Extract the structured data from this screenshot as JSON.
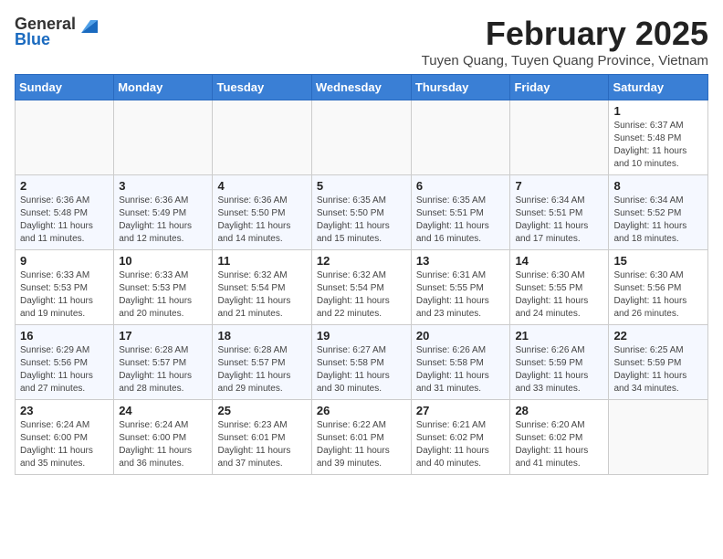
{
  "header": {
    "logo_general": "General",
    "logo_blue": "Blue",
    "month_title": "February 2025",
    "location": "Tuyen Quang, Tuyen Quang Province, Vietnam"
  },
  "weekdays": [
    "Sunday",
    "Monday",
    "Tuesday",
    "Wednesday",
    "Thursday",
    "Friday",
    "Saturday"
  ],
  "weeks": [
    [
      {
        "day": "",
        "detail": ""
      },
      {
        "day": "",
        "detail": ""
      },
      {
        "day": "",
        "detail": ""
      },
      {
        "day": "",
        "detail": ""
      },
      {
        "day": "",
        "detail": ""
      },
      {
        "day": "",
        "detail": ""
      },
      {
        "day": "1",
        "detail": "Sunrise: 6:37 AM\nSunset: 5:48 PM\nDaylight: 11 hours and 10 minutes."
      }
    ],
    [
      {
        "day": "2",
        "detail": "Sunrise: 6:36 AM\nSunset: 5:48 PM\nDaylight: 11 hours and 11 minutes."
      },
      {
        "day": "3",
        "detail": "Sunrise: 6:36 AM\nSunset: 5:49 PM\nDaylight: 11 hours and 12 minutes."
      },
      {
        "day": "4",
        "detail": "Sunrise: 6:36 AM\nSunset: 5:50 PM\nDaylight: 11 hours and 14 minutes."
      },
      {
        "day": "5",
        "detail": "Sunrise: 6:35 AM\nSunset: 5:50 PM\nDaylight: 11 hours and 15 minutes."
      },
      {
        "day": "6",
        "detail": "Sunrise: 6:35 AM\nSunset: 5:51 PM\nDaylight: 11 hours and 16 minutes."
      },
      {
        "day": "7",
        "detail": "Sunrise: 6:34 AM\nSunset: 5:51 PM\nDaylight: 11 hours and 17 minutes."
      },
      {
        "day": "8",
        "detail": "Sunrise: 6:34 AM\nSunset: 5:52 PM\nDaylight: 11 hours and 18 minutes."
      }
    ],
    [
      {
        "day": "9",
        "detail": "Sunrise: 6:33 AM\nSunset: 5:53 PM\nDaylight: 11 hours and 19 minutes."
      },
      {
        "day": "10",
        "detail": "Sunrise: 6:33 AM\nSunset: 5:53 PM\nDaylight: 11 hours and 20 minutes."
      },
      {
        "day": "11",
        "detail": "Sunrise: 6:32 AM\nSunset: 5:54 PM\nDaylight: 11 hours and 21 minutes."
      },
      {
        "day": "12",
        "detail": "Sunrise: 6:32 AM\nSunset: 5:54 PM\nDaylight: 11 hours and 22 minutes."
      },
      {
        "day": "13",
        "detail": "Sunrise: 6:31 AM\nSunset: 5:55 PM\nDaylight: 11 hours and 23 minutes."
      },
      {
        "day": "14",
        "detail": "Sunrise: 6:30 AM\nSunset: 5:55 PM\nDaylight: 11 hours and 24 minutes."
      },
      {
        "day": "15",
        "detail": "Sunrise: 6:30 AM\nSunset: 5:56 PM\nDaylight: 11 hours and 26 minutes."
      }
    ],
    [
      {
        "day": "16",
        "detail": "Sunrise: 6:29 AM\nSunset: 5:56 PM\nDaylight: 11 hours and 27 minutes."
      },
      {
        "day": "17",
        "detail": "Sunrise: 6:28 AM\nSunset: 5:57 PM\nDaylight: 11 hours and 28 minutes."
      },
      {
        "day": "18",
        "detail": "Sunrise: 6:28 AM\nSunset: 5:57 PM\nDaylight: 11 hours and 29 minutes."
      },
      {
        "day": "19",
        "detail": "Sunrise: 6:27 AM\nSunset: 5:58 PM\nDaylight: 11 hours and 30 minutes."
      },
      {
        "day": "20",
        "detail": "Sunrise: 6:26 AM\nSunset: 5:58 PM\nDaylight: 11 hours and 31 minutes."
      },
      {
        "day": "21",
        "detail": "Sunrise: 6:26 AM\nSunset: 5:59 PM\nDaylight: 11 hours and 33 minutes."
      },
      {
        "day": "22",
        "detail": "Sunrise: 6:25 AM\nSunset: 5:59 PM\nDaylight: 11 hours and 34 minutes."
      }
    ],
    [
      {
        "day": "23",
        "detail": "Sunrise: 6:24 AM\nSunset: 6:00 PM\nDaylight: 11 hours and 35 minutes."
      },
      {
        "day": "24",
        "detail": "Sunrise: 6:24 AM\nSunset: 6:00 PM\nDaylight: 11 hours and 36 minutes."
      },
      {
        "day": "25",
        "detail": "Sunrise: 6:23 AM\nSunset: 6:01 PM\nDaylight: 11 hours and 37 minutes."
      },
      {
        "day": "26",
        "detail": "Sunrise: 6:22 AM\nSunset: 6:01 PM\nDaylight: 11 hours and 39 minutes."
      },
      {
        "day": "27",
        "detail": "Sunrise: 6:21 AM\nSunset: 6:02 PM\nDaylight: 11 hours and 40 minutes."
      },
      {
        "day": "28",
        "detail": "Sunrise: 6:20 AM\nSunset: 6:02 PM\nDaylight: 11 hours and 41 minutes."
      },
      {
        "day": "",
        "detail": ""
      }
    ]
  ]
}
